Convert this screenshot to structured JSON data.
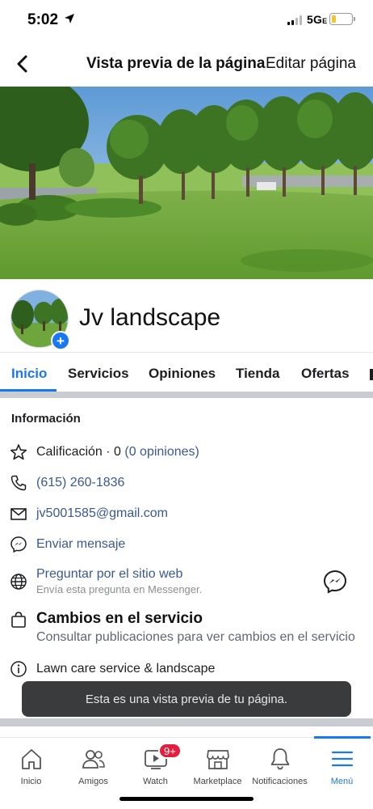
{
  "status_bar": {
    "time": "5:02",
    "network": "5G",
    "network_suffix": "E",
    "battery_level": 0.2,
    "battery_color": "#f4c430"
  },
  "header": {
    "back_icon": "chevron-left-icon",
    "title": "Vista previa de la página",
    "edit_label": "Editar página"
  },
  "profile": {
    "page_name": "Jv landscape",
    "add_icon": "+"
  },
  "tabs": [
    {
      "label": "Inicio",
      "active": true
    },
    {
      "label": "Servicios",
      "active": false
    },
    {
      "label": "Opiniones",
      "active": false
    },
    {
      "label": "Tienda",
      "active": false
    },
    {
      "label": "Ofertas",
      "active": false
    }
  ],
  "info": {
    "heading": "Información",
    "rating_label": "Calificación · 0 ",
    "rating_link": "(0 opiniones)",
    "phone": "(615) 260-1836",
    "email": "jv5001585@gmail.com",
    "send_message": "Enviar mensaje",
    "ask_website": "Preguntar por el sitio web",
    "ask_website_sub": "Envía esta pregunta en Messenger.",
    "services_title": "Cambios en el servicio",
    "services_sub": "Consultar publicaciones para ver cambios en el servicio",
    "category": "Lawn care service & landscape"
  },
  "toast": {
    "message": "Esta es una vista previa de tu página."
  },
  "bottom_nav": [
    {
      "label": "Inicio",
      "icon": "home-icon",
      "active": false
    },
    {
      "label": "Amigos",
      "icon": "friends-icon",
      "active": false
    },
    {
      "label": "Watch",
      "icon": "watch-icon",
      "active": false,
      "badge": "9+"
    },
    {
      "label": "Marketplace",
      "icon": "marketplace-icon",
      "active": false
    },
    {
      "label": "Notificaciones",
      "icon": "bell-icon",
      "active": false
    },
    {
      "label": "Menú",
      "icon": "menu-icon",
      "active": true
    }
  ],
  "colors": {
    "accent": "#1877f2",
    "link": "#385898",
    "badge": "#e41e3f"
  }
}
